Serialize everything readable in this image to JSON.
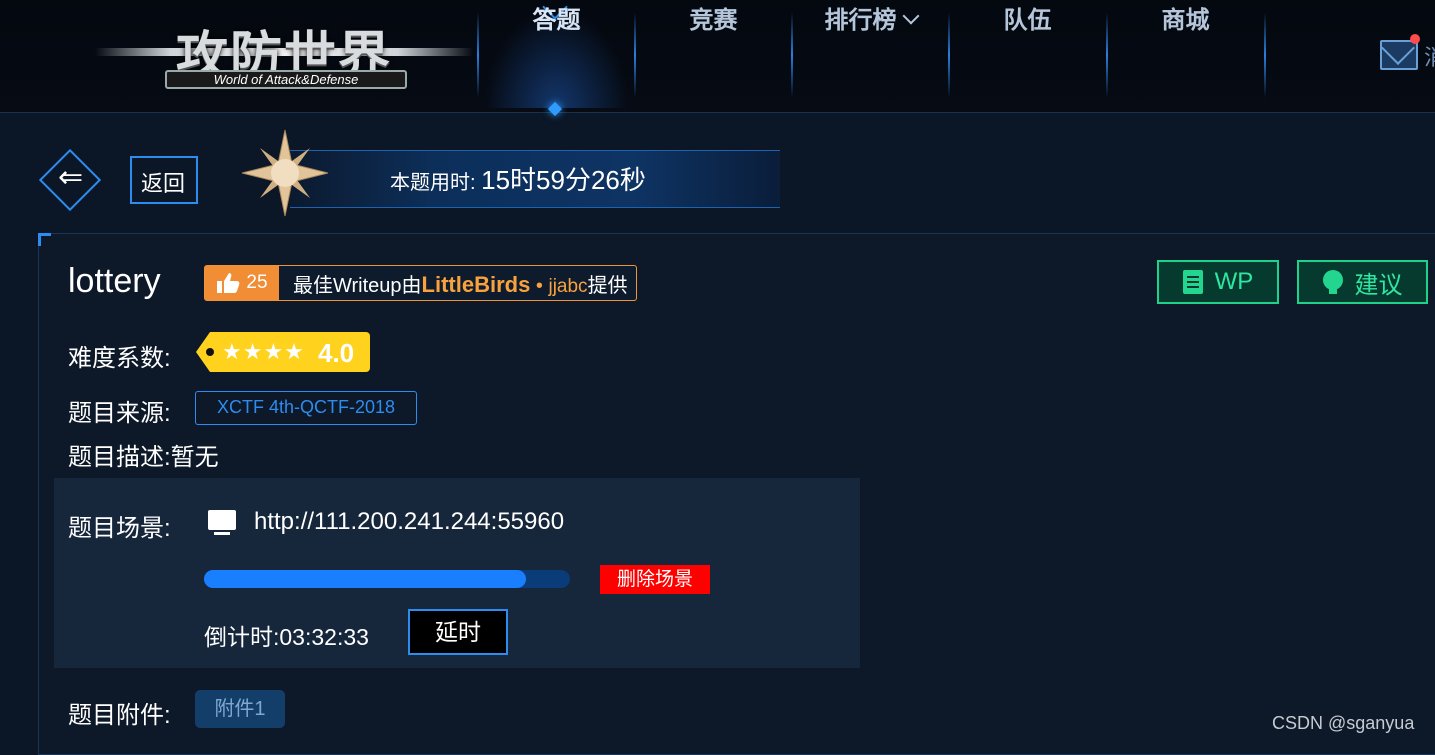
{
  "nav": {
    "logo_cn": "攻防世界",
    "logo_en": "World of Attack&Defense",
    "items": [
      "答题",
      "竞赛",
      "排行榜",
      "队伍",
      "商城"
    ],
    "active": "答题",
    "message_partial": "消"
  },
  "back_label": "返回",
  "timer": {
    "label": "本题用时:",
    "value": "15时59分26秒"
  },
  "challenge": {
    "title": "lottery",
    "likes": "25",
    "wu_prefix": "最佳Writeup由",
    "wu_team": "LittleBirds",
    "wu_dot": "•",
    "wu_user": "jjabc",
    "wu_suffix": "提供",
    "btn_wp": "WP",
    "btn_suggest": "建议"
  },
  "difficulty": {
    "label": "难度系数:",
    "stars": "★★★★",
    "value": "4.0"
  },
  "source": {
    "label": "题目来源:",
    "value": "XCTF 4th-QCTF-2018"
  },
  "description": {
    "label": "题目描述:",
    "value": "暂无"
  },
  "scene": {
    "label": "题目场景:",
    "url": "http://111.200.241.244:55960",
    "progress": 0.88,
    "delete_label": "删除场景",
    "countdown_label": "倒计时:",
    "countdown": "03:32:33",
    "extend_label": "延时"
  },
  "attachment": {
    "label": "题目附件:",
    "button": "附件1"
  },
  "watermark": "CSDN @sganyua",
  "colors": {
    "accent": "#2d8cf0",
    "green": "#1ed28c",
    "orange": "#f08d35",
    "yellow": "#ffd21e",
    "danger": "#ff0000"
  }
}
